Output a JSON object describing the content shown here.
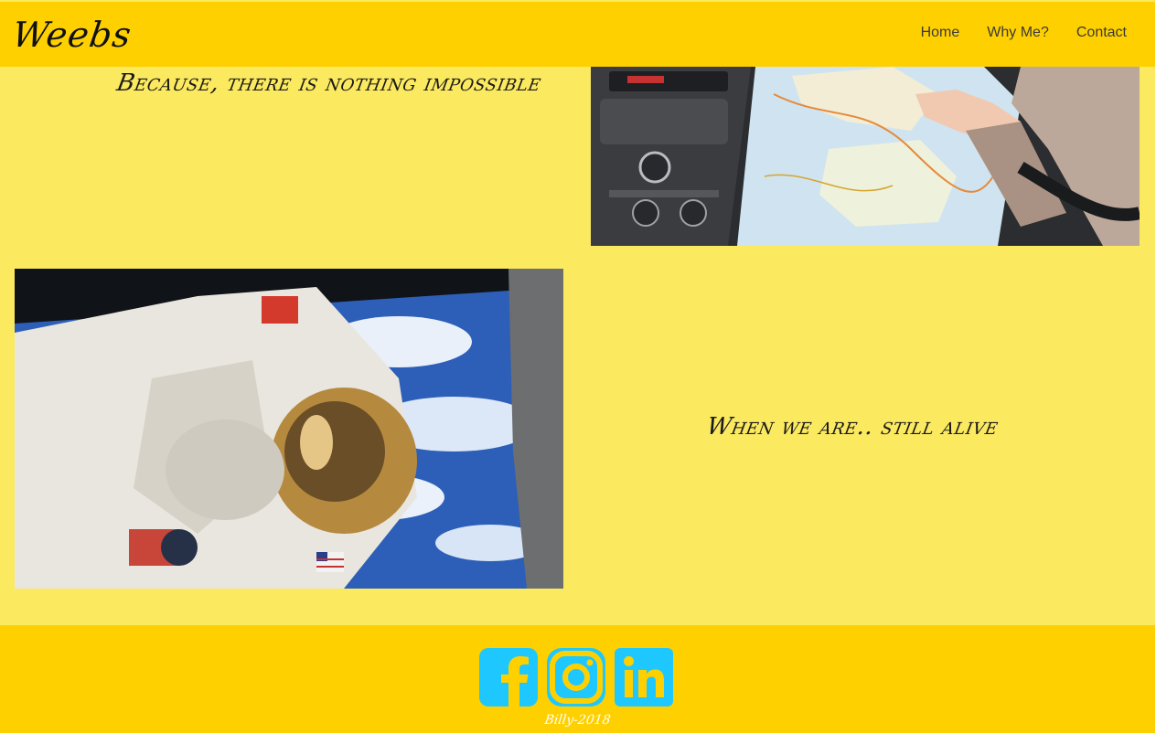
{
  "header": {
    "logo": "Weebs",
    "nav": [
      {
        "label": "Home"
      },
      {
        "label": "Why Me?"
      },
      {
        "label": "Contact"
      }
    ]
  },
  "sections": [
    {
      "heading": "Because, there is nothing impossible",
      "image": "hands-on-map-in-car-photo"
    },
    {
      "heading": "When we are.. still alive",
      "image": "astronaut-spacewalk-photo"
    }
  ],
  "footer": {
    "socials": [
      {
        "icon": "facebook-icon"
      },
      {
        "icon": "instagram-icon"
      },
      {
        "icon": "linkedin-icon"
      }
    ],
    "credit": "Billy-2018"
  },
  "colors": {
    "header_bg": "#ffd000",
    "page_bg": "#fbe960",
    "social_icon": "#1ec8ff",
    "text_dark": "#1b1b1b"
  }
}
